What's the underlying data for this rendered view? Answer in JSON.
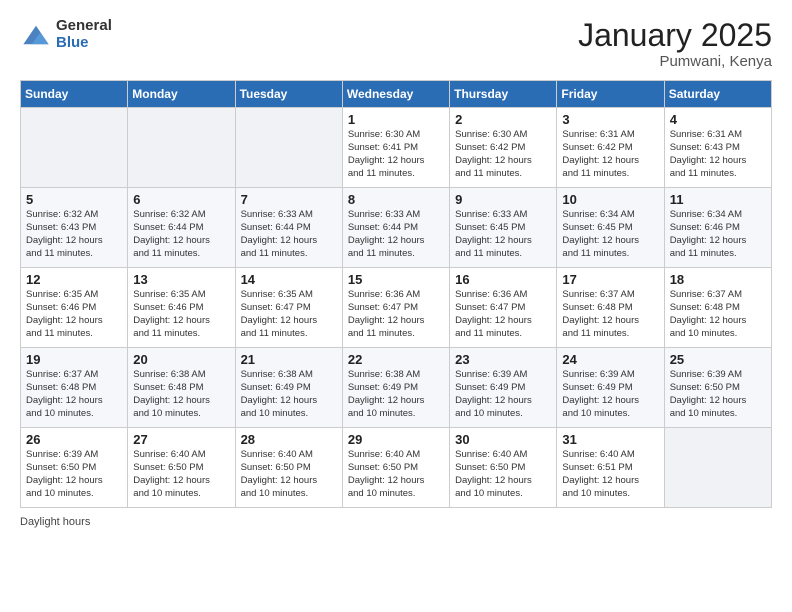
{
  "header": {
    "logo_general": "General",
    "logo_blue": "Blue",
    "month_title": "January 2025",
    "location": "Pumwani, Kenya"
  },
  "weekdays": [
    "Sunday",
    "Monday",
    "Tuesday",
    "Wednesday",
    "Thursday",
    "Friday",
    "Saturday"
  ],
  "weeks": [
    [
      {
        "day": "",
        "info": ""
      },
      {
        "day": "",
        "info": ""
      },
      {
        "day": "",
        "info": ""
      },
      {
        "day": "1",
        "info": "Sunrise: 6:30 AM\nSunset: 6:41 PM\nDaylight: 12 hours\nand 11 minutes."
      },
      {
        "day": "2",
        "info": "Sunrise: 6:30 AM\nSunset: 6:42 PM\nDaylight: 12 hours\nand 11 minutes."
      },
      {
        "day": "3",
        "info": "Sunrise: 6:31 AM\nSunset: 6:42 PM\nDaylight: 12 hours\nand 11 minutes."
      },
      {
        "day": "4",
        "info": "Sunrise: 6:31 AM\nSunset: 6:43 PM\nDaylight: 12 hours\nand 11 minutes."
      }
    ],
    [
      {
        "day": "5",
        "info": "Sunrise: 6:32 AM\nSunset: 6:43 PM\nDaylight: 12 hours\nand 11 minutes."
      },
      {
        "day": "6",
        "info": "Sunrise: 6:32 AM\nSunset: 6:44 PM\nDaylight: 12 hours\nand 11 minutes."
      },
      {
        "day": "7",
        "info": "Sunrise: 6:33 AM\nSunset: 6:44 PM\nDaylight: 12 hours\nand 11 minutes."
      },
      {
        "day": "8",
        "info": "Sunrise: 6:33 AM\nSunset: 6:44 PM\nDaylight: 12 hours\nand 11 minutes."
      },
      {
        "day": "9",
        "info": "Sunrise: 6:33 AM\nSunset: 6:45 PM\nDaylight: 12 hours\nand 11 minutes."
      },
      {
        "day": "10",
        "info": "Sunrise: 6:34 AM\nSunset: 6:45 PM\nDaylight: 12 hours\nand 11 minutes."
      },
      {
        "day": "11",
        "info": "Sunrise: 6:34 AM\nSunset: 6:46 PM\nDaylight: 12 hours\nand 11 minutes."
      }
    ],
    [
      {
        "day": "12",
        "info": "Sunrise: 6:35 AM\nSunset: 6:46 PM\nDaylight: 12 hours\nand 11 minutes."
      },
      {
        "day": "13",
        "info": "Sunrise: 6:35 AM\nSunset: 6:46 PM\nDaylight: 12 hours\nand 11 minutes."
      },
      {
        "day": "14",
        "info": "Sunrise: 6:35 AM\nSunset: 6:47 PM\nDaylight: 12 hours\nand 11 minutes."
      },
      {
        "day": "15",
        "info": "Sunrise: 6:36 AM\nSunset: 6:47 PM\nDaylight: 12 hours\nand 11 minutes."
      },
      {
        "day": "16",
        "info": "Sunrise: 6:36 AM\nSunset: 6:47 PM\nDaylight: 12 hours\nand 11 minutes."
      },
      {
        "day": "17",
        "info": "Sunrise: 6:37 AM\nSunset: 6:48 PM\nDaylight: 12 hours\nand 11 minutes."
      },
      {
        "day": "18",
        "info": "Sunrise: 6:37 AM\nSunset: 6:48 PM\nDaylight: 12 hours\nand 10 minutes."
      }
    ],
    [
      {
        "day": "19",
        "info": "Sunrise: 6:37 AM\nSunset: 6:48 PM\nDaylight: 12 hours\nand 10 minutes."
      },
      {
        "day": "20",
        "info": "Sunrise: 6:38 AM\nSunset: 6:48 PM\nDaylight: 12 hours\nand 10 minutes."
      },
      {
        "day": "21",
        "info": "Sunrise: 6:38 AM\nSunset: 6:49 PM\nDaylight: 12 hours\nand 10 minutes."
      },
      {
        "day": "22",
        "info": "Sunrise: 6:38 AM\nSunset: 6:49 PM\nDaylight: 12 hours\nand 10 minutes."
      },
      {
        "day": "23",
        "info": "Sunrise: 6:39 AM\nSunset: 6:49 PM\nDaylight: 12 hours\nand 10 minutes."
      },
      {
        "day": "24",
        "info": "Sunrise: 6:39 AM\nSunset: 6:49 PM\nDaylight: 12 hours\nand 10 minutes."
      },
      {
        "day": "25",
        "info": "Sunrise: 6:39 AM\nSunset: 6:50 PM\nDaylight: 12 hours\nand 10 minutes."
      }
    ],
    [
      {
        "day": "26",
        "info": "Sunrise: 6:39 AM\nSunset: 6:50 PM\nDaylight: 12 hours\nand 10 minutes."
      },
      {
        "day": "27",
        "info": "Sunrise: 6:40 AM\nSunset: 6:50 PM\nDaylight: 12 hours\nand 10 minutes."
      },
      {
        "day": "28",
        "info": "Sunrise: 6:40 AM\nSunset: 6:50 PM\nDaylight: 12 hours\nand 10 minutes."
      },
      {
        "day": "29",
        "info": "Sunrise: 6:40 AM\nSunset: 6:50 PM\nDaylight: 12 hours\nand 10 minutes."
      },
      {
        "day": "30",
        "info": "Sunrise: 6:40 AM\nSunset: 6:50 PM\nDaylight: 12 hours\nand 10 minutes."
      },
      {
        "day": "31",
        "info": "Sunrise: 6:40 AM\nSunset: 6:51 PM\nDaylight: 12 hours\nand 10 minutes."
      },
      {
        "day": "",
        "info": ""
      }
    ]
  ],
  "footer": {
    "daylight_label": "Daylight hours"
  }
}
